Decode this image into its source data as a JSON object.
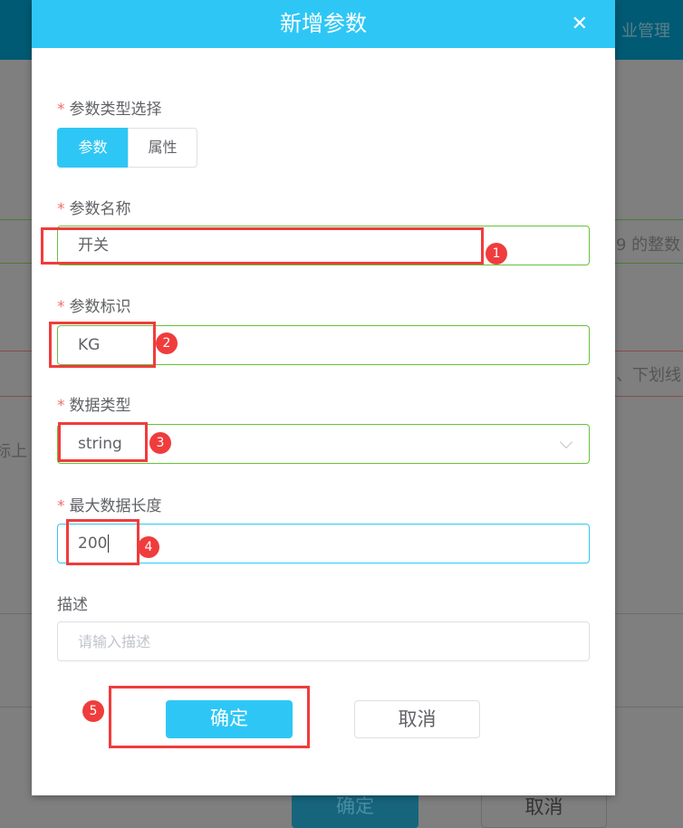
{
  "background": {
    "header_text": "业管理",
    "hint_1": "9 的整数",
    "hint_2": "、下划线",
    "hint_3": "标上",
    "confirm": "确定",
    "cancel": "取消"
  },
  "dialog": {
    "title": "新增参数",
    "close_icon": "close-x-icon",
    "param_type": {
      "label": "参数类型选择",
      "options": [
        "参数",
        "属性"
      ],
      "selected": "参数"
    },
    "param_name": {
      "label": "参数名称",
      "value": "开关"
    },
    "param_id": {
      "label": "参数标识",
      "value": "KG"
    },
    "data_type": {
      "label": "数据类型",
      "value": "string"
    },
    "max_length": {
      "label": "最大数据长度",
      "value": "200"
    },
    "description": {
      "label": "描述",
      "placeholder": "请输入描述"
    },
    "confirm": "确定",
    "cancel": "取消",
    "required_mark": "*"
  },
  "annotations": [
    "1",
    "2",
    "3",
    "4",
    "5"
  ],
  "colors": {
    "accent": "#2ec7f5",
    "valid": "#67c23a",
    "annotation": "#f03c3c",
    "header_bg": "#005a73"
  }
}
